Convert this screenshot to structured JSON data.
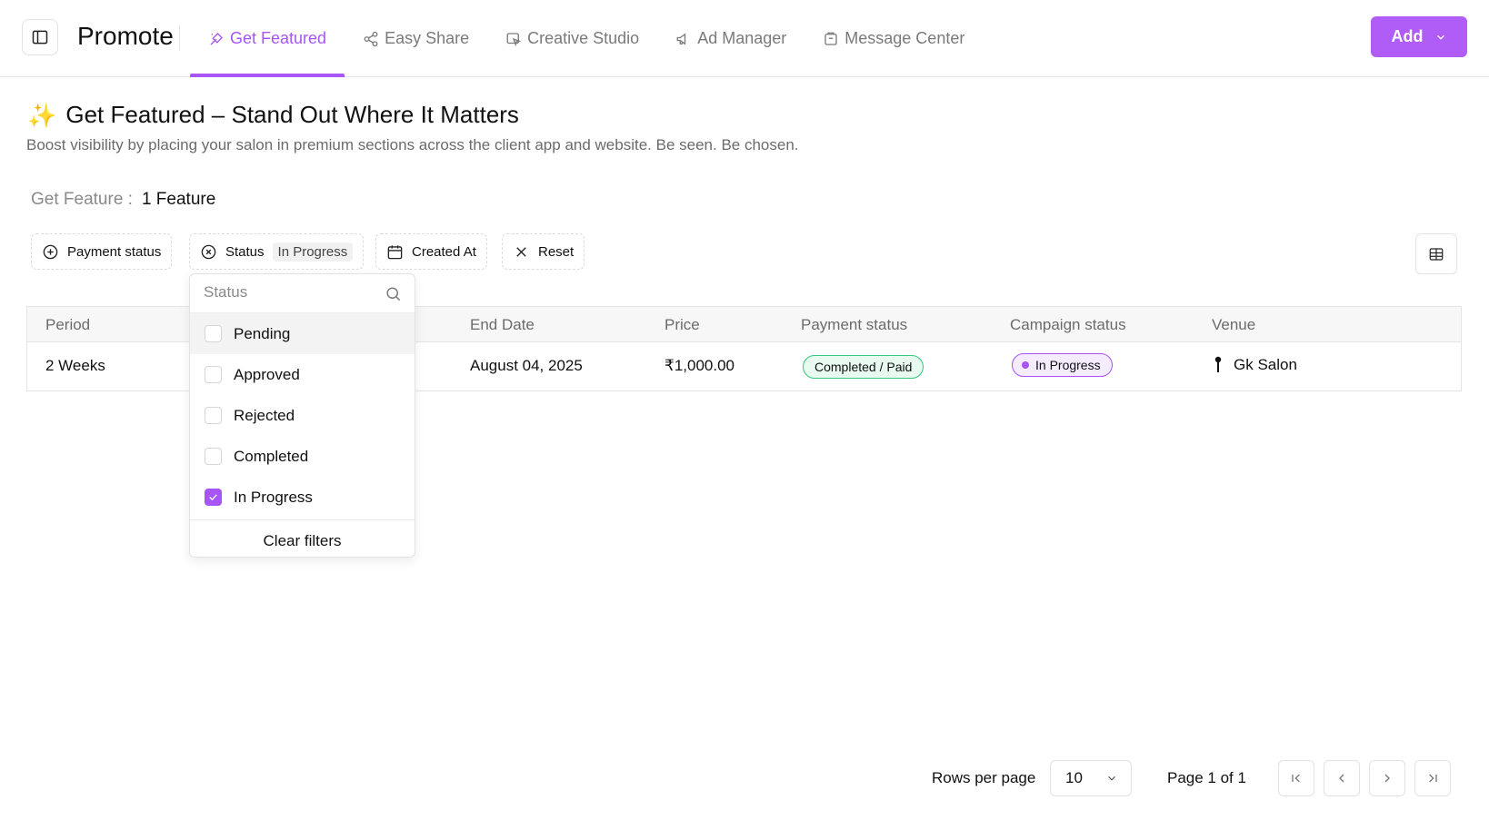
{
  "header": {
    "app_title": "Promote",
    "tabs": [
      {
        "label": "Get Featured",
        "icon": "sparkle-pen-icon",
        "active": true
      },
      {
        "label": "Easy Share",
        "icon": "share-icon",
        "active": false
      },
      {
        "label": "Creative Studio",
        "icon": "creative-studio-icon",
        "active": false
      },
      {
        "label": "Ad Manager",
        "icon": "megaphone-icon",
        "active": false
      },
      {
        "label": "Message Center",
        "icon": "message-box-icon",
        "active": false
      }
    ],
    "add_label": "Add"
  },
  "page": {
    "emoji": "✨",
    "title": "Get Featured – Stand Out Where It Matters",
    "subtitle": "Boost visibility by placing your salon in premium sections across the client app and website. Be seen. Be chosen.",
    "count_label": "Get Feature :",
    "count_value": "1 Feature"
  },
  "filters": {
    "payment_status": "Payment status",
    "status": "Status",
    "status_chip": "In Progress",
    "created_at": "Created At",
    "reset": "Reset"
  },
  "table": {
    "columns": [
      "Period",
      "End Date",
      "Price",
      "Payment status",
      "Campaign status",
      "Venue"
    ],
    "rows": [
      {
        "period": "2 Weeks",
        "end_date": "August 04, 2025",
        "price": "₹1,000.00",
        "payment_status": "Completed / Paid",
        "campaign_status": "In Progress",
        "venue": "Gk Salon"
      }
    ]
  },
  "status_dropdown": {
    "search_placeholder": "Status",
    "options": [
      {
        "label": "Pending",
        "checked": false
      },
      {
        "label": "Approved",
        "checked": false
      },
      {
        "label": "Rejected",
        "checked": false
      },
      {
        "label": "Completed",
        "checked": false
      },
      {
        "label": "In Progress",
        "checked": true
      }
    ],
    "clear_label": "Clear filters"
  },
  "pagination": {
    "rows_per_page_label": "Rows per page",
    "rows_per_page_value": "10",
    "page_label": "Page 1 of 1"
  },
  "colors": {
    "accent": "#a855f7",
    "add_button": "#b05cf6",
    "paid_badge_border": "#34c97a",
    "paid_badge_bg": "#e9faf0"
  }
}
